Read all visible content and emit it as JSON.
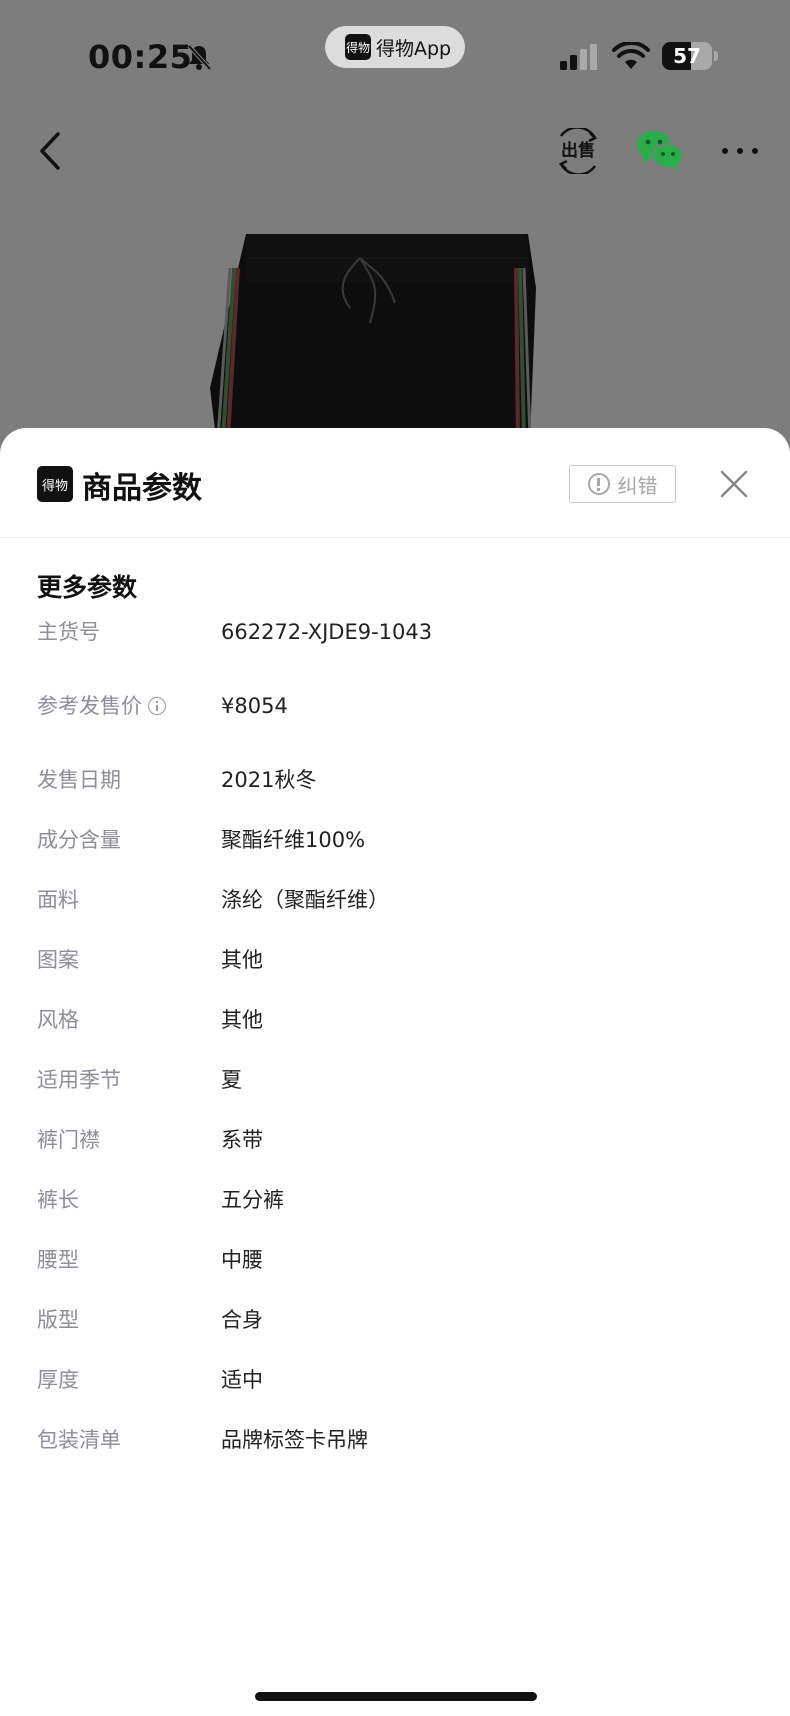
{
  "status_bar": {
    "time": "00:25",
    "app_pill": "得物App",
    "app_logo": "得物",
    "battery_level": "57",
    "battery_fraction": 0.57
  },
  "nav": {
    "sell_label": "出售"
  },
  "sheet": {
    "logo_text": "得物",
    "title": "商品参数",
    "report_label": "纠错",
    "section_title": "更多参数"
  },
  "params": [
    {
      "label": "主货号",
      "value": "662272-XJDE9-1043"
    },
    {
      "label": "参考发售价",
      "value": "¥8054",
      "info": true
    },
    {
      "label": "发售日期",
      "value": "2021秋冬"
    },
    {
      "label": "成分含量",
      "value": "聚酯纤维100%"
    },
    {
      "label": "面料",
      "value": "涤纶（聚酯纤维）"
    },
    {
      "label": "图案",
      "value": "其他"
    },
    {
      "label": "风格",
      "value": "其他"
    },
    {
      "label": "适用季节",
      "value": "夏"
    },
    {
      "label": "裤门襟",
      "value": "系带"
    },
    {
      "label": "裤长",
      "value": "五分裤"
    },
    {
      "label": "腰型",
      "value": "中腰"
    },
    {
      "label": "版型",
      "value": "合身"
    },
    {
      "label": "厚度",
      "value": "适中"
    },
    {
      "label": "包装清单",
      "value": "品牌标签卡吊牌"
    }
  ],
  "colors": {
    "overlay": "#7d7d7d",
    "wechat_green": "#2aae4a",
    "label_gray": "#8e8e98"
  }
}
